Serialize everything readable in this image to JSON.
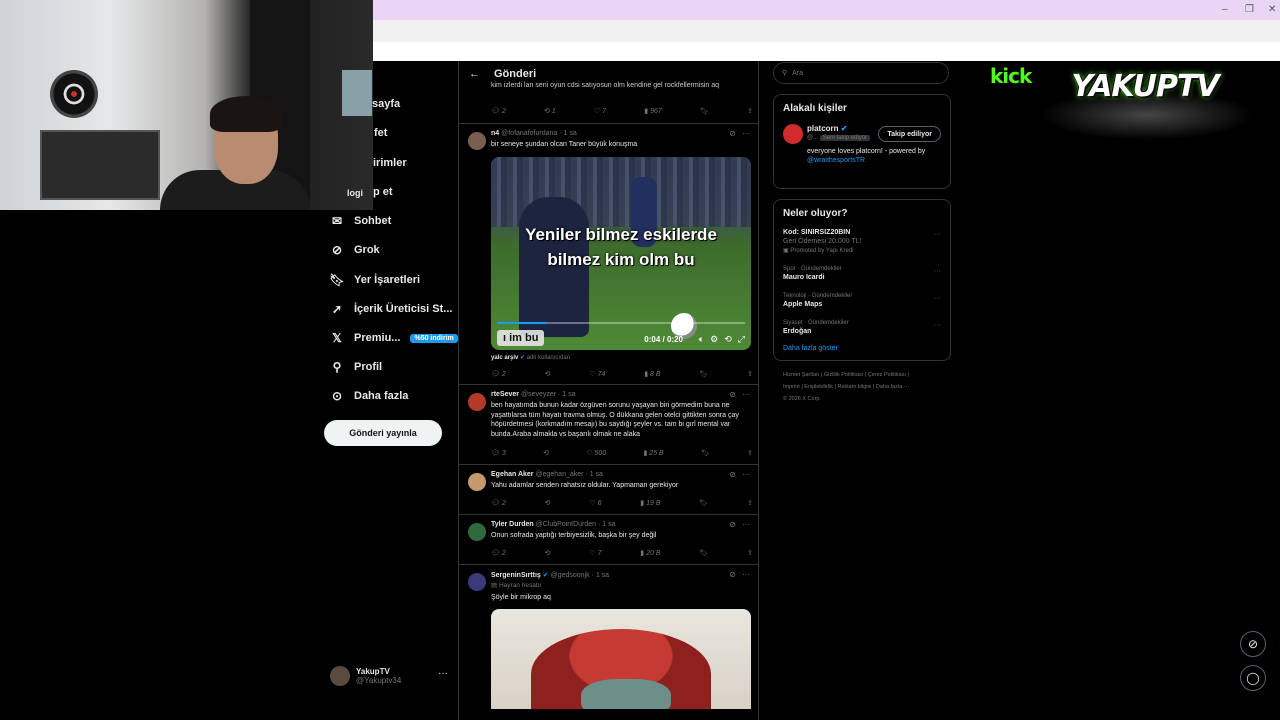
{
  "browser": {
    "window_controls": [
      "–",
      "❐",
      "✕"
    ]
  },
  "webcam": {
    "overlay_text": "logi"
  },
  "sidebar": {
    "partial_items": [
      "sayfa",
      "fet",
      "irimler",
      "p et"
    ],
    "items": [
      {
        "label": "Sohbet",
        "icon": "mail-icon"
      },
      {
        "label": "Grok",
        "icon": "grok-icon"
      },
      {
        "label": "Yer İşaretleri",
        "icon": "bookmark-icon"
      },
      {
        "label": "İçerik Üreticisi St...",
        "icon": "rocket-icon"
      },
      {
        "label": "Premiu...",
        "icon": "x-logo-icon",
        "badge": "%50 indirim"
      },
      {
        "label": "Profil",
        "icon": "person-icon"
      },
      {
        "label": "Daha fazla",
        "icon": "more-circle-icon"
      }
    ],
    "post_button": "Gönderi yayınla",
    "account": {
      "name": "YakupTV",
      "handle": "@Yakuptv34"
    }
  },
  "main": {
    "header_title": "Gönderi",
    "prev_post": {
      "text": "oyun satıyorsun olm kendine gel rockfellermisin aq",
      "text_top": "kim izlerdi lan seni oyun cdsi satıyosun olm kendine gel rockfellermisin aq",
      "replies": "2",
      "reposts": "1",
      "likes": "7",
      "views": "967"
    },
    "tweets": [
      {
        "name": "n4",
        "handle": "@fofanafofurdana",
        "time": "1 sa",
        "text": "bir seneye şundan olcan Taner büyük konuşma",
        "video": {
          "caption_line1": "Yeniler bilmez eskilerde",
          "caption_line2": "bilmez kim olm bu",
          "watermark": "ı im bu",
          "time": "0:04 / 0:20",
          "progress": 0.2
        },
        "source": "yalc arşiv",
        "source_note": "adlı kullanıcıdan",
        "replies": "2",
        "reposts": "",
        "likes": "74",
        "views": "8 B"
      },
      {
        "name": "rteSever",
        "handle": "@seveyzer",
        "time": "1 sa",
        "text": "ben hayatımda bunun kadar özgüven sorunu yaşayan biri görmedim buna ne yaşattılarsa tüm hayatı travma olmuş. O dükkana gelen otelci gittikten sonra çay höpürdetmesi (korkmadım mesajı) bu saydığı şeyler vs. tam bi gırl mental var bunda.Araba almakla vs başarılı olmak ne alaka",
        "replies": "3",
        "reposts": "",
        "likes": "500",
        "views": "25 B"
      },
      {
        "name": "Egehan Aker",
        "handle": "@egehan_aker",
        "time": "1 sa",
        "text": "Yahu adamlar senden rahatsız oldular. Yapmaman gerekiyor",
        "replies": "2",
        "reposts": "",
        "likes": "6",
        "views": "19 B"
      },
      {
        "name": "Tyler Durden",
        "handle": "@ClubPointDurden",
        "time": "1 sa",
        "text": "Onun sofrada yaptığı terbiyesizlik, başka bir şey değil",
        "replies": "2",
        "reposts": "",
        "likes": "7",
        "views": "20 B"
      },
      {
        "name": "SergeninSırttış",
        "handle": "@gedsoonjk",
        "time": "1 sa",
        "label": "Hayran hesabı",
        "text": "Şöyle bir mikrop aq"
      }
    ]
  },
  "right": {
    "search_placeholder": "Ara",
    "related_title": "Alakalı kişiler",
    "related": {
      "name": "platcorn",
      "handle": "@...",
      "follows_you": "Seni takip ediyor",
      "follow_button": "Takip ediliyor",
      "bio": "everyone loves platcorn! - powered by",
      "bio_link": "@wraithesportsTR"
    },
    "trends_title": "Neler oluyor?",
    "trends": [
      {
        "category": "",
        "title": "Kod: SINIRSIZ20BIN",
        "sub": "Geri Ödemesi 20.000 TL!",
        "promo": "Promoted by Yapı Kredi"
      },
      {
        "category": "Spor · Gündemdekiler",
        "title": "Mauro Icardi"
      },
      {
        "category": "Teknoloji · Gündemdekiler",
        "title": "Apple Maps"
      },
      {
        "category": "Siyaset · Gündemdekiler",
        "title": "Erdoğan"
      }
    ],
    "show_more": "Daha fazla göster",
    "footer_line1": "Hizmet Şartları  |  Gizlilik Politikası  |  Çerez Politikası  |",
    "footer_line2": "Imprint  |  Erişilebilirlik  |  Reklam bilgisi  |  Daha fazla ···",
    "footer_line3": "© 2026 X Corp."
  },
  "overlay": {
    "kick": "kick",
    "channel": "YAKUPTV"
  }
}
